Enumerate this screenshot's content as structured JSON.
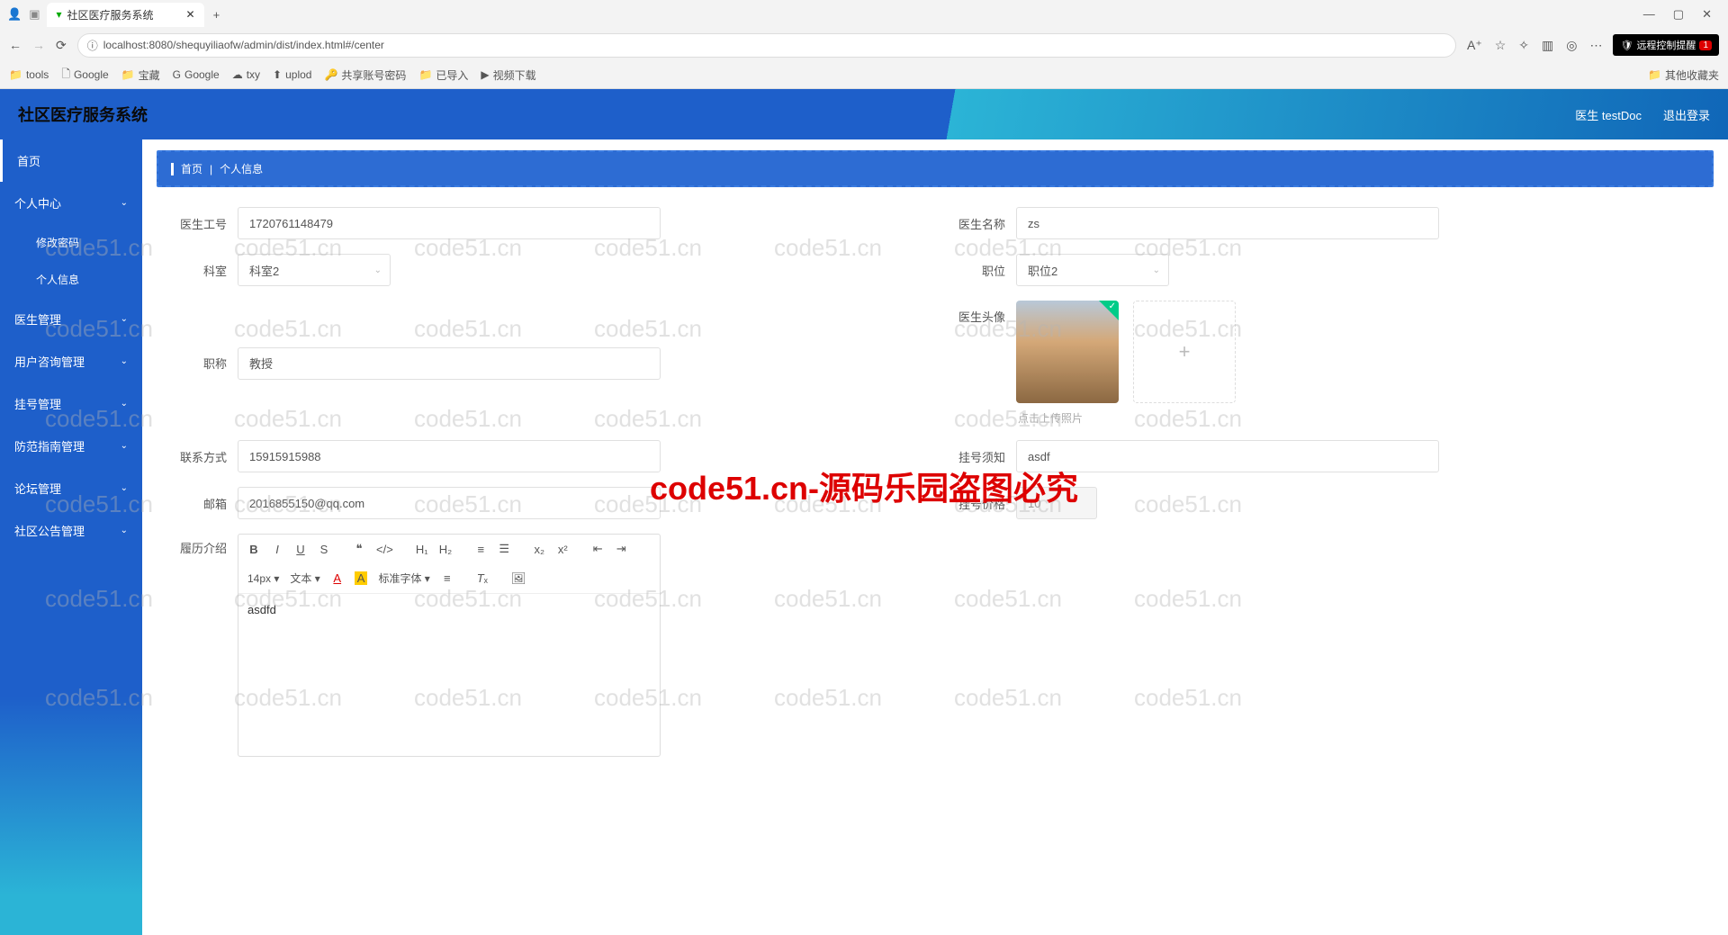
{
  "browser": {
    "tab_title": "社区医疗服务系统",
    "url": "localhost:8080/shequyiliaofw/admin/dist/index.html#/center",
    "remote_notice": "远程控制提醒",
    "remote_count": "1",
    "win_min": "—",
    "win_max": "▢",
    "win_close": "✕"
  },
  "bookmarks": {
    "items": [
      "tools",
      "Google",
      "宝藏",
      "Google",
      "txy",
      "uplod",
      "共享账号密码",
      "已导入",
      "视频下载"
    ],
    "overflow": "其他收藏夹"
  },
  "header": {
    "app_title": "社区医疗服务系统",
    "user_label": "医生 testDoc",
    "logout": "退出登录"
  },
  "sidebar": {
    "home": "首页",
    "items": [
      {
        "label": "个人中心",
        "expanded": true
      },
      {
        "label": "医生管理",
        "expanded": false
      },
      {
        "label": "用户咨询管理",
        "expanded": false
      },
      {
        "label": "挂号管理",
        "expanded": false
      },
      {
        "label": "防范指南管理",
        "expanded": false
      },
      {
        "label": "论坛管理",
        "expanded": false
      },
      {
        "label": "社区公告管理",
        "expanded": false
      }
    ],
    "sub_items": [
      "修改密码",
      "个人信息"
    ]
  },
  "breadcrumb": {
    "root": "首页",
    "sep": "|",
    "current": "个人信息"
  },
  "form": {
    "doctor_id": {
      "label": "医生工号",
      "value": "1720761148479"
    },
    "doctor_name": {
      "label": "医生名称",
      "value": "zs"
    },
    "department": {
      "label": "科室",
      "value": "科室2"
    },
    "position": {
      "label": "职位",
      "value": "职位2"
    },
    "title": {
      "label": "职称",
      "value": "教授"
    },
    "avatar": {
      "label": "医生头像",
      "hint": "点击上传照片"
    },
    "phone": {
      "label": "联系方式",
      "value": "15915915988"
    },
    "notice": {
      "label": "挂号须知",
      "value": "asdf"
    },
    "email": {
      "label": "邮箱",
      "value": "2016855150@qq.com"
    },
    "price": {
      "label": "挂号价格",
      "value": "10"
    },
    "resume": {
      "label": "履历介绍",
      "content": "asdfd"
    }
  },
  "editor": {
    "font_size": "14px",
    "text_type": "文本",
    "font_family": "标准字体"
  },
  "watermark": {
    "text": "code51.cn",
    "big": "code51.cn-源码乐园盗图必究"
  }
}
